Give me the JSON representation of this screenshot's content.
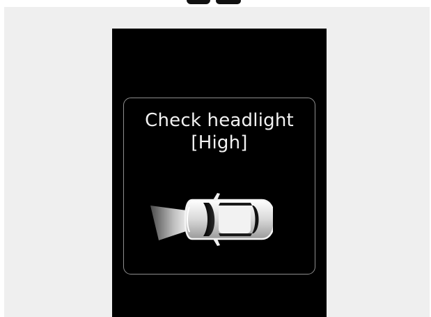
{
  "warning": {
    "line1": "Check headlight",
    "line2": "[High]"
  },
  "icons": {
    "car": "car-top-view-headlight-icon"
  },
  "colors": {
    "background": "#efefef",
    "display": "#000000",
    "text": "#f2f2f2",
    "frame": "#8f8f8f"
  }
}
